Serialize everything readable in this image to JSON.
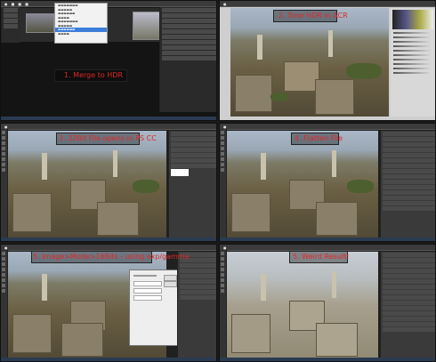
{
  "panels": [
    {
      "id": "p1",
      "caption": "1. Merge to HDR"
    },
    {
      "id": "p2",
      "caption": "2. Tone HDR in ACR"
    },
    {
      "id": "p3",
      "caption": "3. 32Bit File opens in PS CC"
    },
    {
      "id": "p4",
      "caption": "4. Flatten File"
    },
    {
      "id": "p5",
      "caption": "5. Image>Mode>16Bits - using exp/gamma"
    },
    {
      "id": "p6",
      "caption": "5. Weird Result!"
    }
  ],
  "colors": {
    "caption": "#e12727",
    "menu_highlight": "#3d7edb",
    "ps_dark": "#202020"
  },
  "icons": [
    "apple-icon",
    "histogram-icon",
    "dock-icon"
  ]
}
